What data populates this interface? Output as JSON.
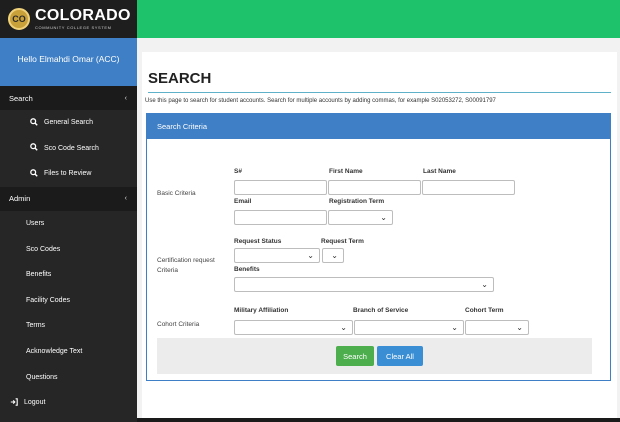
{
  "header": {
    "logo_seal": "CO",
    "logo_main": "COLORADO",
    "logo_sub": "COMMUNITY COLLEGE SYSTEM"
  },
  "sidebar": {
    "greeting": "Hello Elmahdi Omar (ACC)",
    "search_section": "Search",
    "search_items": [
      {
        "label": "General Search",
        "icon": "search-icon"
      },
      {
        "label": "Sco Code Search",
        "icon": "search-icon"
      },
      {
        "label": "Files to Review",
        "icon": "search-icon"
      }
    ],
    "admin_section": "Admin",
    "admin_items": [
      "Users",
      "Sco Codes",
      "Benefits",
      "Facility Codes",
      "Terms",
      "Acknowledge Text",
      "Questions"
    ],
    "logout": "Logout",
    "section_chevron": "‹"
  },
  "main": {
    "title": "SEARCH",
    "intro": "Use this page to search for student accounts. Search for multiple accounts by adding commas, for example S02053272, S00091797",
    "card_title": "Search Criteria",
    "basic": {
      "label": "Basic Criteria",
      "sid_label": "S#",
      "first_name_label": "First Name",
      "last_name_label": "Last Name",
      "email_label": "Email",
      "reg_term_label": "Registration Term"
    },
    "cert": {
      "label_line1": "Certification request",
      "label_line2": "Criteria",
      "request_status_label": "Request Status",
      "request_term_label": "Request Term",
      "benefits_label": "Benefits"
    },
    "cohort": {
      "label": "Cohort Criteria",
      "military_label": "Military Affiliation",
      "branch_label": "Branch of Service",
      "cohort_term_label": "Cohort Term"
    },
    "buttons": {
      "search": "Search",
      "clear": "Clear All"
    },
    "caret": "⌄"
  },
  "colors": {
    "topbar": "#1dc26b",
    "accent_blue": "#3f7fc6",
    "sidebar": "#262626",
    "search_button": "#4cae4c",
    "clear_button": "#3a8fd4"
  }
}
